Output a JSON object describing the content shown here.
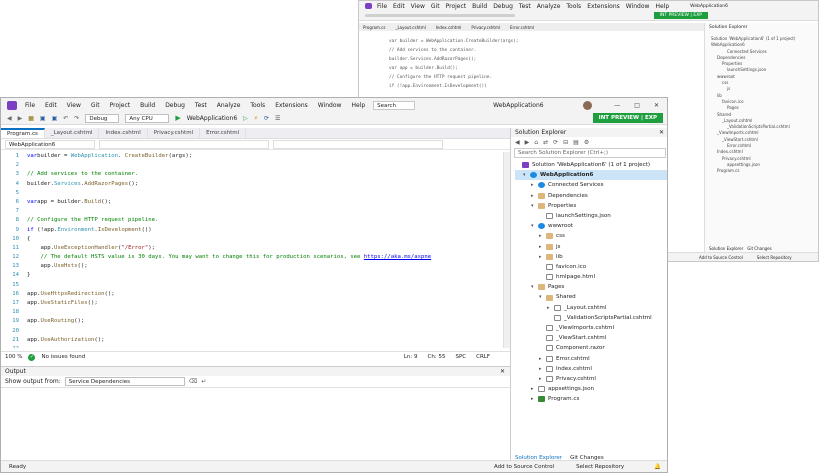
{
  "back_window": {
    "menu": [
      "File",
      "Edit",
      "View",
      "Git",
      "Project",
      "Build",
      "Debug",
      "Test",
      "Analyze",
      "Tools",
      "Extensions",
      "Window",
      "Help"
    ],
    "title": "WebApplication6",
    "preview_button": "INT PREVIEW | EXP",
    "tabs": [
      "Program.cs",
      "_Layout.cshtml",
      "Index.cshtml",
      "Privacy.cshtml",
      "Error.cshtml"
    ],
    "code": [
      "var builder = WebApplication.CreateBuilder(args);",
      "// Add services to the container.",
      "builder.Services.AddRazorPages();",
      "var app = builder.Build();",
      "// Configure the HTTP request pipeline.",
      "if (!app.Environment.IsDevelopment())"
    ],
    "se_title": "Solution Explorer",
    "se_items": [
      "Solution 'WebApplication6' (1 of 1 project)",
      "WebApplication6",
      "Connected Services",
      "Dependencies",
      "Properties",
      "launchSettings.json",
      "wwwroot",
      "css",
      "js",
      "lib",
      "favicon.ico",
      "Pages",
      "Shared",
      "_Layout.cshtml",
      "_ValidationScriptsPartial.cshtml",
      "_ViewImports.cshtml",
      "_ViewStart.cshtml",
      "Error.cshtml",
      "Index.cshtml",
      "Privacy.cshtml",
      "appsettings.json",
      "Program.cs"
    ],
    "se_tabs": [
      "Solution Explorer",
      "Git Changes"
    ],
    "status": [
      "Add to Source Control",
      "Select Repository"
    ]
  },
  "menu": {
    "items": [
      "File",
      "Edit",
      "View",
      "Git",
      "Project",
      "Build",
      "Debug",
      "Test",
      "Analyze",
      "Tools",
      "Extensions",
      "Window",
      "Help"
    ],
    "search": "Search (Ctrl+Q)",
    "title": "WebApplication6"
  },
  "toolbar": {
    "config": "Debug",
    "platform": "Any CPU",
    "run_target": "WebApplication6",
    "preview_button": "INT PREVIEW | EXP"
  },
  "tabs": [
    "Program.cs",
    "_Layout.cshtml",
    "Index.cshtml",
    "Privacy.cshtml",
    "Error.cshtml"
  ],
  "editor": {
    "nav_project": "WebApplication6",
    "lines": [
      {
        "n": "1",
        "parts": [
          [
            "kw",
            "var"
          ],
          [
            "",
            "builder = "
          ],
          [
            "ty",
            "WebApplication"
          ],
          [
            "",
            ". "
          ],
          [
            "mt",
            "CreateBuilder"
          ],
          [
            "",
            "(args);"
          ]
        ]
      },
      {
        "n": "2",
        "parts": []
      },
      {
        "n": "3",
        "parts": [
          [
            "cm",
            "// Add services to the container."
          ]
        ]
      },
      {
        "n": "4",
        "parts": [
          [
            "",
            "builder."
          ],
          [
            "ty",
            "Services"
          ],
          [
            "",
            "."
          ],
          [
            "mt",
            "AddRazorPages"
          ],
          [
            "",
            "();"
          ]
        ]
      },
      {
        "n": "5",
        "parts": []
      },
      {
        "n": "6",
        "parts": [
          [
            "kw",
            "var"
          ],
          [
            "",
            "app = builder."
          ],
          [
            "mt",
            "Build"
          ],
          [
            "",
            "();"
          ]
        ]
      },
      {
        "n": "7",
        "parts": []
      },
      {
        "n": "8",
        "parts": [
          [
            "cm",
            "// Configure the HTTP request pipeline."
          ]
        ]
      },
      {
        "n": "9",
        "parts": [
          [
            "kw",
            "if"
          ],
          [
            "",
            " (!app."
          ],
          [
            "ty",
            "Environment"
          ],
          [
            "",
            "."
          ],
          [
            "mt",
            "IsDevelopment"
          ],
          [
            "",
            "())"
          ]
        ]
      },
      {
        "n": "10",
        "parts": [
          [
            "",
            "{"
          ]
        ]
      },
      {
        "n": "11",
        "parts": [
          [
            "",
            "    app."
          ],
          [
            "mt",
            "UseExceptionHandler"
          ],
          [
            "",
            "("
          ],
          [
            "st",
            "\"/Error\""
          ],
          [
            "",
            ");"
          ]
        ]
      },
      {
        "n": "12",
        "parts": [
          [
            "cm",
            "    // The default HSTS value is 30 days. You may want to change this for production scenarios, see "
          ],
          [
            "lk",
            "https://aka.ms/aspne"
          ]
        ]
      },
      {
        "n": "13",
        "parts": [
          [
            "",
            "    app."
          ],
          [
            "mt",
            "UseHsts"
          ],
          [
            "",
            "();"
          ]
        ]
      },
      {
        "n": "14",
        "parts": [
          [
            "",
            "}"
          ]
        ]
      },
      {
        "n": "15",
        "parts": []
      },
      {
        "n": "16",
        "parts": [
          [
            "",
            "app."
          ],
          [
            "mt",
            "UseHttpsRedirection"
          ],
          [
            "",
            "();"
          ]
        ]
      },
      {
        "n": "17",
        "parts": [
          [
            "",
            "app."
          ],
          [
            "mt",
            "UseStaticFiles"
          ],
          [
            "",
            "();"
          ]
        ]
      },
      {
        "n": "18",
        "parts": []
      },
      {
        "n": "19",
        "parts": [
          [
            "",
            "app."
          ],
          [
            "mt",
            "UseRouting"
          ],
          [
            "",
            "();"
          ]
        ]
      },
      {
        "n": "20",
        "parts": []
      },
      {
        "n": "21",
        "parts": [
          [
            "",
            "app."
          ],
          [
            "mt",
            "UseAuthorization"
          ],
          [
            "",
            "();"
          ]
        ]
      },
      {
        "n": "22",
        "parts": []
      },
      {
        "n": "23",
        "parts": [
          [
            "",
            "app."
          ],
          [
            "mt",
            "MapRazorPages"
          ],
          [
            "",
            "();"
          ]
        ]
      },
      {
        "n": "24",
        "parts": []
      }
    ],
    "zoom": "100 %",
    "issues": "No issues found",
    "position": [
      "Ln: 9",
      "Ch: 55",
      "SPC",
      "CRLF"
    ]
  },
  "output": {
    "title": "Output",
    "show_from_label": "Show output from:",
    "show_from_value": "Service Dependencies"
  },
  "solution_explorer": {
    "title": "Solution Explorer",
    "search": "Search Solution Explorer (Ctrl+;)",
    "items": [
      {
        "label": "Solution 'WebApplication6' (1 of 1 project)",
        "depth": 0,
        "icon": "proj",
        "tri": ""
      },
      {
        "label": "WebApplication6",
        "depth": 1,
        "icon": "web",
        "tri": "▾",
        "bold": true
      },
      {
        "label": "Connected Services",
        "depth": 2,
        "icon": "web",
        "tri": "▸"
      },
      {
        "label": "Dependencies",
        "depth": 2,
        "icon": "folder",
        "tri": "▸"
      },
      {
        "label": "Properties",
        "depth": 2,
        "icon": "folder",
        "tri": "▾"
      },
      {
        "label": "launchSettings.json",
        "depth": 3,
        "icon": "file",
        "tri": ""
      },
      {
        "label": "wwwroot",
        "depth": 2,
        "icon": "web",
        "tri": "▾"
      },
      {
        "label": "css",
        "depth": 3,
        "icon": "folder",
        "tri": "▸"
      },
      {
        "label": "js",
        "depth": 3,
        "icon": "folder",
        "tri": "▸"
      },
      {
        "label": "lib",
        "depth": 3,
        "icon": "folder",
        "tri": "▸"
      },
      {
        "label": "favicon.ico",
        "depth": 3,
        "icon": "file",
        "tri": ""
      },
      {
        "label": "hmlpage.html",
        "depth": 3,
        "icon": "file",
        "tri": ""
      },
      {
        "label": "Pages",
        "depth": 2,
        "icon": "folder",
        "tri": "▾"
      },
      {
        "label": "Shared",
        "depth": 3,
        "icon": "folder",
        "tri": "▾"
      },
      {
        "label": "_Layout.cshtml",
        "depth": 4,
        "icon": "file",
        "tri": "▸"
      },
      {
        "label": "_ValidationScriptsPartial.cshtml",
        "depth": 4,
        "icon": "file",
        "tri": ""
      },
      {
        "label": "_ViewImports.cshtml",
        "depth": 3,
        "icon": "file",
        "tri": ""
      },
      {
        "label": "_ViewStart.cshtml",
        "depth": 3,
        "icon": "file",
        "tri": ""
      },
      {
        "label": "Component.razor",
        "depth": 3,
        "icon": "file",
        "tri": ""
      },
      {
        "label": "Error.cshtml",
        "depth": 3,
        "icon": "file",
        "tri": "▸"
      },
      {
        "label": "Index.cshtml",
        "depth": 3,
        "icon": "file",
        "tri": "▸"
      },
      {
        "label": "Privacy.cshtml",
        "depth": 3,
        "icon": "file",
        "tri": "▸"
      },
      {
        "label": "appsettings.json",
        "depth": 2,
        "icon": "file",
        "tri": "▸"
      },
      {
        "label": "Program.cs",
        "depth": 2,
        "icon": "cs",
        "tri": "▸"
      }
    ],
    "bottom_tabs": [
      "Solution Explorer",
      "Git Changes"
    ]
  },
  "status": {
    "left": "Ready",
    "source_control": "Add to Source Control",
    "repository": "Select Repository",
    "accent": "#0e70c0",
    "preview_green": "#1e9e3e"
  }
}
